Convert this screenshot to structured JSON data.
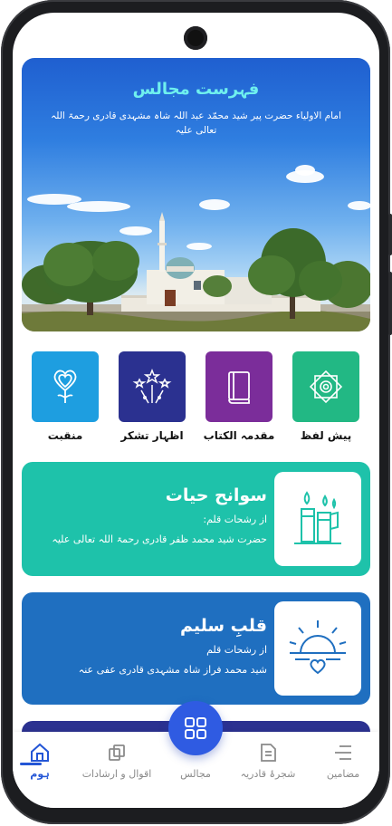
{
  "hero": {
    "title": "فہرست مجالس",
    "subtitle": "امام الاولیاء حضرت پیر شید محمّد عبد اللہ شاہ مشہدی قادری رحمۃ اللہ تعالی علیہ"
  },
  "tiles": [
    {
      "label": "پیش لفظ",
      "color": "#22b884",
      "icon": "book-star-icon"
    },
    {
      "label": "مقدمہ الکتاب",
      "color": "#7b2d9a",
      "icon": "book-icon"
    },
    {
      "label": "اظہار تشکر",
      "color": "#2b3190",
      "icon": "fireworks-icon"
    },
    {
      "label": "منقبت",
      "color": "#1e9ee0",
      "icon": "heart-flower-icon"
    }
  ],
  "cards": [
    {
      "title": "سوانح حیات",
      "subtitle": "از رشحات قلم:",
      "author": "حضرت شید محمد ظفر قادری رحمۃ اللہ تعالی علیہ",
      "color": "#1ec2aa",
      "icon": "candles-icon"
    },
    {
      "title": "قلبِ سلیم",
      "subtitle": "از رشحات قلم",
      "author": "شید محمد فراز شاہ مشہدی قادری عفی عنہ",
      "color": "#1f6fc0",
      "icon": "sunrise-heart-icon"
    }
  ],
  "nav": {
    "items": [
      {
        "label": "ہوم",
        "icon": "home-icon",
        "active": true
      },
      {
        "label": "اقوال و ارشادات",
        "icon": "copy-icon",
        "active": false
      },
      {
        "label": "مجالس",
        "icon": "",
        "active": false
      },
      {
        "label": "شجرۂ قادریہ",
        "icon": "document-icon",
        "active": false
      },
      {
        "label": "مضامین",
        "icon": "menu-icon",
        "active": false
      }
    ],
    "fab_icon": "grid-icon"
  },
  "colors": {
    "accent": "#2456d6",
    "fab": "#2f5be2",
    "hero_title": "#6ff0ee"
  }
}
